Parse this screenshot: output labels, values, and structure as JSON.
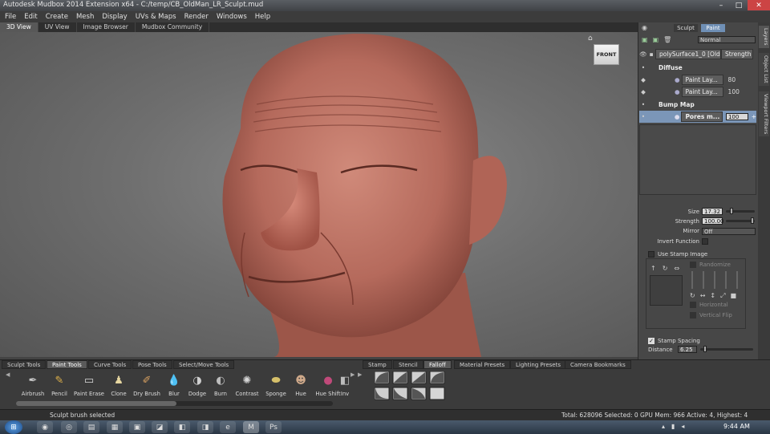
{
  "window": {
    "title": "Autodesk Mudbox 2014 Extension x64 - C:/temp/CB_OldMan_LR_Sculpt.mud"
  },
  "menu": [
    "File",
    "Edit",
    "Create",
    "Mesh",
    "Display",
    "UVs & Maps",
    "Render",
    "Windows",
    "Help"
  ],
  "view_tabs": [
    "3D View",
    "UV View",
    "Image Browser",
    "Mudbox Community"
  ],
  "viewcube": {
    "face_label": "FRONT"
  },
  "right_panel": {
    "mode_tabs": [
      "Sculpt",
      "Paint"
    ],
    "blend_mode": "Normal",
    "object": {
      "name": "polySurface1_0 [Old",
      "strength_header": "Strength"
    },
    "groups": [
      {
        "name": "Diffuse",
        "layers": [
          {
            "name": "Paint Lay...",
            "value": "80"
          },
          {
            "name": "Paint Lay...",
            "value": "100"
          }
        ]
      },
      {
        "name": "Bump Map",
        "layers": [
          {
            "name": "Pores m...",
            "value": "100"
          }
        ]
      }
    ],
    "properties": {
      "size_label": "Size",
      "size_value": "17.32",
      "strength_label": "Strength",
      "strength_value": "100.00",
      "mirror_label": "Mirror",
      "mirror_value": "Off",
      "invert_label": "Invert Function",
      "use_stamp_label": "Use Stamp Image",
      "randomize_label": "Randomize",
      "horizontal_label": "Horizontal",
      "vertical_label": "Vertical Flip",
      "stamp_spacing_label": "Stamp Spacing",
      "distance_label": "Distance",
      "distance_value": "6.25"
    },
    "side_tabs": [
      "Layers",
      "Object List",
      "Viewport Filters"
    ]
  },
  "tool_tabs": [
    "Sculpt Tools",
    "Paint Tools",
    "Curve Tools",
    "Pose Tools",
    "Select/Move Tools"
  ],
  "tools": [
    {
      "label": "Airbrush",
      "icon": "airbrush-icon",
      "glyph": "✒",
      "color": "#c9c9c9"
    },
    {
      "label": "Pencil",
      "icon": "pencil-icon",
      "glyph": "✎",
      "color": "#e0b24a"
    },
    {
      "label": "Paint Erase",
      "icon": "eraser-icon",
      "glyph": "▭",
      "color": "#dadada"
    },
    {
      "label": "Clone",
      "icon": "clone-icon",
      "glyph": "♟",
      "color": "#e6d6a0"
    },
    {
      "label": "Dry Brush",
      "icon": "dry-brush-icon",
      "glyph": "✐",
      "color": "#d8a060"
    },
    {
      "label": "Blur",
      "icon": "blur-icon",
      "glyph": "💧",
      "color": "#dcdcdc"
    },
    {
      "label": "Dodge",
      "icon": "dodge-icon",
      "glyph": "◑",
      "color": "#cfcfcf"
    },
    {
      "label": "Burn",
      "icon": "burn-icon",
      "glyph": "◐",
      "color": "#bdbdbd"
    },
    {
      "label": "Contrast",
      "icon": "contrast-icon",
      "glyph": "✺",
      "color": "#d8d8d8"
    },
    {
      "label": "Sponge",
      "icon": "sponge-icon",
      "glyph": "⬬",
      "color": "#d6c06a"
    },
    {
      "label": "Hue",
      "icon": "hue-icon",
      "glyph": "☻",
      "color": "#cfa98a"
    },
    {
      "label": "Hue Shift",
      "icon": "hue-shift-icon",
      "glyph": "●",
      "color": "#c04a7a"
    },
    {
      "label": "Inv",
      "icon": "invert-icon",
      "glyph": "◧",
      "color": "#bbbbbb"
    }
  ],
  "tray_tabs": [
    "Stamp",
    "Stencil",
    "Falloff",
    "Material Presets",
    "Lighting Presets",
    "Camera Bookmarks"
  ],
  "status": {
    "left": "Sculpt brush selected",
    "right": "Total: 628096  Selected: 0 GPU Mem: 966  Active: 4, Highest: 4"
  },
  "taskbar": {
    "clock": "9:44 AM"
  },
  "colors": {
    "accent": "#6f8fb5",
    "selected_row": "#7b96b8",
    "skin": "#c47a6c"
  }
}
